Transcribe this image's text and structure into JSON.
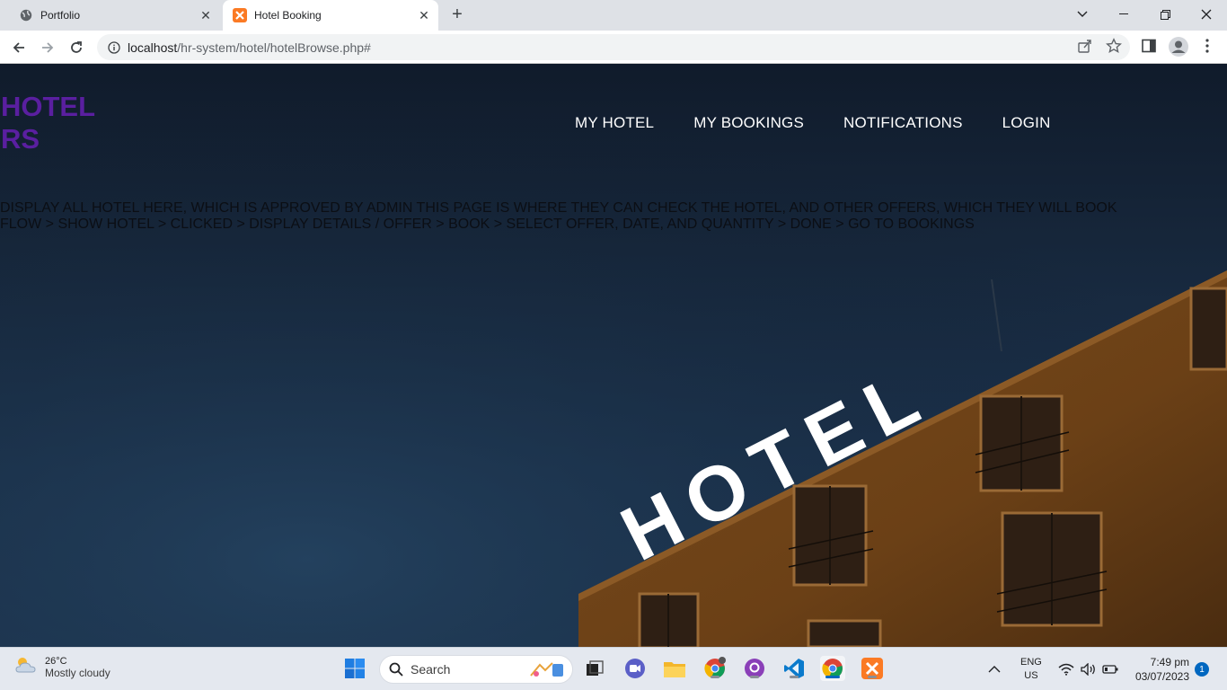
{
  "browser": {
    "tabs": [
      {
        "title": "Portfolio",
        "active": false
      },
      {
        "title": "Hotel Booking",
        "active": true
      }
    ],
    "url_host": "localhost",
    "url_path": "/hr-system/hotel/hotelBrowse.php#"
  },
  "site": {
    "brand_line1": "HOTEL",
    "brand_line2": "RS",
    "nav": [
      "MY HOTEL",
      "MY BOOKINGS",
      "NOTIFICATIONS",
      "LOGIN"
    ],
    "desc_line1": "DISPLAY ALL HOTEL HERE, WHICH IS APPROVED BY ADMIN THIS PAGE IS WHERE THEY CAN CHECK THE HOTEL, AND OTHER OFFERS, WHICH THEY WILL BOOK",
    "desc_line2": "FLOW > SHOW HOTEL > CLICKED > DISPLAY DETAILS / OFFER > BOOK > SELECT OFFER, DATE, AND QUANTITY > DONE > GO TO BOOKINGS",
    "sign_text": "HOTEL"
  },
  "taskbar": {
    "weather_temp": "26°C",
    "weather_cond": "Mostly cloudy",
    "search_label": "Search",
    "lang_1": "ENG",
    "lang_2": "US",
    "time": "7:49 pm",
    "date": "03/07/2023",
    "notification_count": "1"
  },
  "colors": {
    "brand": "#5a1fa0",
    "active_taskbar": "#0067c0"
  }
}
